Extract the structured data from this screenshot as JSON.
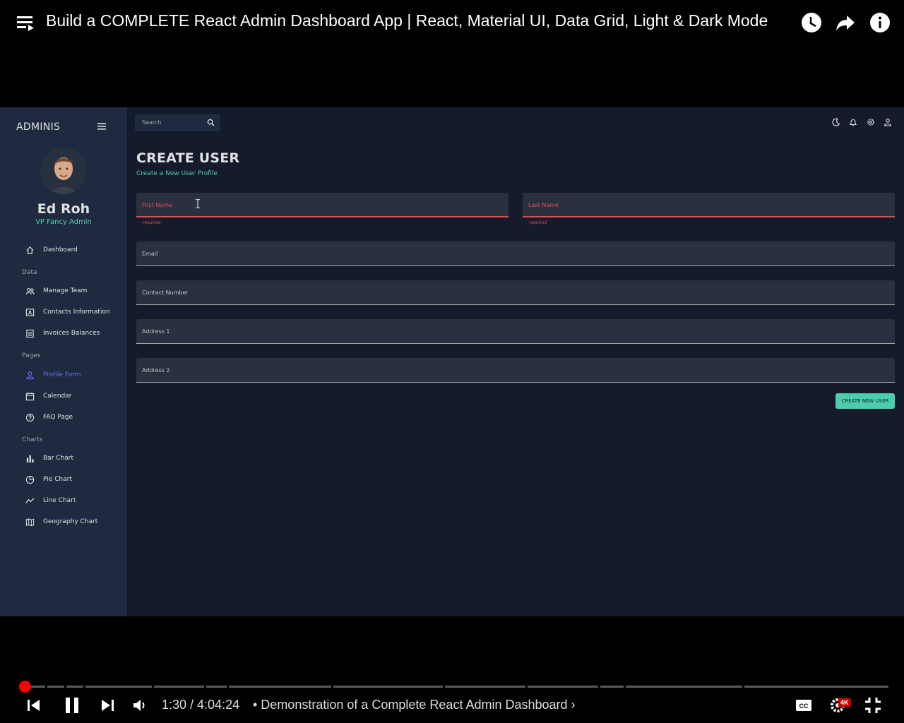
{
  "player": {
    "video_title": "Build a COMPLETE React Admin Dashboard App | React, Material UI, Data Grid, Light & Dark Mode",
    "current_time": "1:30",
    "duration": "4:04:24",
    "time_display": "1:30 / 4:04:24",
    "chapter": "• Demonstration of a Complete React Admin Dashboard",
    "quality_badge": "4K",
    "progress_fraction": 0.006
  },
  "app": {
    "brand": "ADMINIS",
    "profile": {
      "name": "Ed Roh",
      "role": "VP Fancy Admin"
    },
    "search_placeholder": "Search",
    "nav": {
      "dashboard": "Dashboard",
      "section_data": "Data",
      "manage_team": "Manage Team",
      "contacts": "Contacts Information",
      "invoices": "Invoices Balances",
      "section_pages": "Pages",
      "profile_form": "Profile Form",
      "calendar": "Calendar",
      "faq": "FAQ Page",
      "section_charts": "Charts",
      "bar_chart": "Bar Chart",
      "pie_chart": "Pie Chart",
      "line_chart": "Line Chart",
      "geo_chart": "Geography Chart"
    },
    "page": {
      "title": "CREATE USER",
      "subtitle": "Create a New User Profile"
    },
    "form": {
      "first_name": "First Name",
      "last_name": "Last Name",
      "required_text": "required",
      "email": "Email",
      "contact": "Contact Number",
      "address1": "Address 1",
      "address2": "Address 2",
      "submit": "CREATE NEW USER"
    }
  },
  "colors": {
    "bg": "#141b2d",
    "sidebar": "#1f2a40",
    "accent_green": "#4cceac",
    "accent_blue": "#6870fa",
    "error_red": "#db4f4a",
    "progress_red": "#ff0000"
  }
}
